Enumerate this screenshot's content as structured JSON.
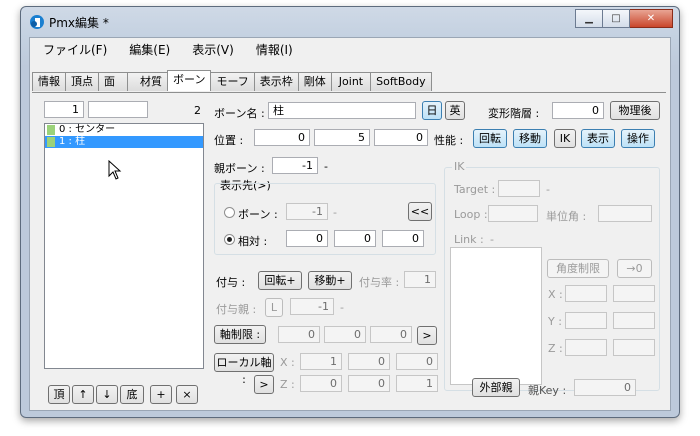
{
  "window": {
    "title": "Pmx編集 *",
    "min": "▁",
    "max": "□",
    "close": "✕"
  },
  "menu": [
    "ファイル(F)",
    "編集(E)",
    "表示(V)",
    "情報(I)"
  ],
  "tabs": [
    "情報",
    "頂点",
    "面",
    "材質",
    "ボーン",
    "モーフ",
    "表示枠",
    "剛体",
    "Joint",
    "SoftBody"
  ],
  "active_tab": "ボーン",
  "list": {
    "index_value": "1",
    "search_value": "",
    "count": "2",
    "items": [
      {
        "label": "0 : センター",
        "selected": false
      },
      {
        "label": "1 : 柱",
        "selected": true
      }
    ],
    "buttons": [
      "頂",
      "↑",
      "↓",
      "底",
      "+",
      "×"
    ]
  },
  "bone": {
    "name_label": "ボーン名 :",
    "name_value": "柱",
    "lang_jp": "日",
    "lang_en": "英",
    "deform_label": "変形階層 :",
    "deform_value": "0",
    "after_physics": "物理後",
    "position_label": "位置 :",
    "position": [
      "0",
      "5",
      "0"
    ],
    "perf_label": "性能 :",
    "perf_buttons": [
      "回転",
      "移動",
      "IK",
      "表示",
      "操作"
    ],
    "parent_label": "親ボーン :",
    "parent_value": "-1",
    "parent_suffix": "-",
    "display_target_label": "表示先(>)",
    "dt_bone_label": "ボーン :",
    "dt_bone_value": "-1",
    "dt_bone_suffix": "-",
    "dt_bone_button": "<<",
    "dt_rel_label": "相対 :",
    "dt_rel_values": [
      "0",
      "0",
      "0"
    ],
    "grant_label": "付与 :",
    "grant_rot": "回転+",
    "grant_move": "移動+",
    "grant_rate_label": "付与率 :",
    "grant_rate_value": "1",
    "grant_parent_label": "付与親 :",
    "grant_parent_L": "L",
    "grant_parent_value": "-1",
    "grant_parent_suffix": "-",
    "axis_limit_label": "軸制限 :",
    "axis_values": [
      "0",
      "0",
      "0"
    ],
    "axis_button": ">",
    "local_axis_label": "ローカル軸 :",
    "local_button": ">",
    "local_x_label": "X :",
    "local_x": [
      "1",
      "0",
      "0"
    ],
    "local_z_label": "Z :",
    "local_z": [
      "0",
      "0",
      "1"
    ]
  },
  "ik": {
    "title": "IK",
    "target_label": "Target :",
    "target_suffix": "-",
    "loop_label": "Loop :",
    "unit_label": "単位角 :",
    "link_label": "Link :",
    "link_suffix": "-",
    "angle_limit": "角度制限",
    "arrow_zero": "→0",
    "x_label": "X :",
    "y_label": "Y :",
    "z_label": "Z :"
  },
  "external": {
    "button": "外部親",
    "key_label": "親Key :",
    "key_value": "0"
  },
  "colors": {
    "selection": "#3399ff",
    "morph_marker": "#9bd27a",
    "blue_button": "#bde2f7"
  }
}
